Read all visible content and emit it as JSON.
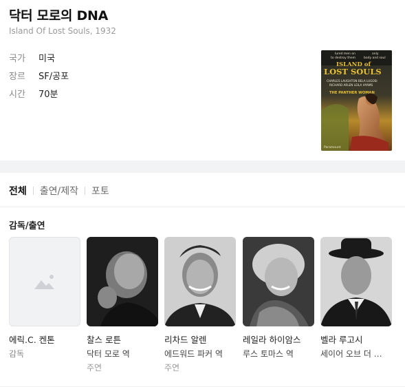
{
  "movie": {
    "title": "닥터 모로의 DNA",
    "original_title": "Island Of Lost Souls, 1932",
    "info": [
      {
        "label": "국가",
        "value": "미국"
      },
      {
        "label": "장르",
        "value": "SF/공포"
      },
      {
        "label": "시간",
        "value": "70분"
      }
    ],
    "poster": {
      "tagline_1": "lured men on",
      "tagline_2": "only",
      "tagline_3": "to destroy them",
      "tagline_4": "body and soul",
      "title_line1": "ISLAND of",
      "title_line2": "LOST SOULS",
      "credits_1": "CHARLES LAUGHTON   BELA LUGOSI",
      "credits_2": "RICHARD ARLEN   LEILA HYAMS",
      "subtitle": "THE PANTHER WOMAN",
      "studio": "Paramount",
      "colors": {
        "bg_top": "#2a2a22",
        "bg_mid": "#c9a030",
        "title": "#e8c232"
      }
    }
  },
  "tabs": [
    {
      "label": "전체",
      "active": true
    },
    {
      "label": "출연/제작",
      "active": false
    },
    {
      "label": "포토",
      "active": false
    }
  ],
  "section": {
    "title": "감독/출연"
  },
  "people": [
    {
      "name": "에릭.C. 켄톤",
      "role": "감독",
      "type": "",
      "photo": "placeholder-image-icon"
    },
    {
      "name": "찰스 로튼",
      "role": "닥터 모로 역",
      "type": "주연",
      "photo": "photo"
    },
    {
      "name": "리차드 알렌",
      "role": "에드워드 파커 역",
      "type": "주연",
      "photo": "photo"
    },
    {
      "name": "레일라 하이암스",
      "role": "루스 토마스 역",
      "type": "",
      "photo": "photo"
    },
    {
      "name": "벨라 루고시",
      "role": "세이어 오브 더 …",
      "type": "",
      "photo": "photo"
    }
  ]
}
